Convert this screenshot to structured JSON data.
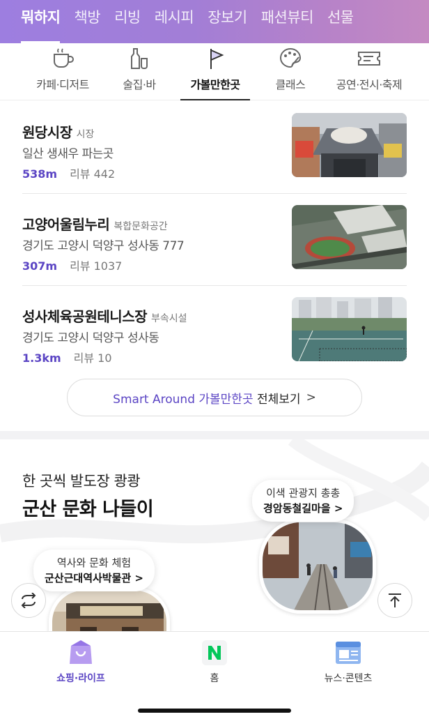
{
  "top_nav": {
    "tabs": [
      "뭐하지",
      "책방",
      "리빙",
      "레시피",
      "장보기",
      "패션뷰티",
      "선물"
    ],
    "active_index": 0
  },
  "categories": {
    "items": [
      {
        "label": "카페·디저트",
        "icon": "coffee-cup-icon"
      },
      {
        "label": "술집·바",
        "icon": "bottles-icon"
      },
      {
        "label": "가볼만한곳",
        "icon": "flag-icon"
      },
      {
        "label": "클래스",
        "icon": "palette-icon"
      },
      {
        "label": "공연·전시·축제",
        "icon": "ticket-icon"
      }
    ],
    "active_index": 2
  },
  "places": [
    {
      "name": "원당시장",
      "kind": "시장",
      "address": "일산 생새우 파는곳",
      "distance": "538m",
      "reviews": "리뷰 442"
    },
    {
      "name": "고양어울림누리",
      "kind": "복합문화공간",
      "address": "경기도 고양시 덕양구 성사동 777",
      "distance": "307m",
      "reviews": "리뷰 1037"
    },
    {
      "name": "성사체육공원테니스장",
      "kind": "부속시설",
      "address": "경기도 고양시 덕양구 성사동",
      "distance": "1.3km",
      "reviews": "리뷰 10"
    }
  ],
  "see_all": {
    "brand": "Smart Around 가볼만한곳",
    "text": "전체보기",
    "arrow": ">"
  },
  "promo": {
    "subtitle": "한 곳씩 발도장 쾅쾅",
    "title": "군산 문화 나들이",
    "spot_right": {
      "line1": "이색 관광지 총총",
      "line2": "경암동철길마을 >"
    },
    "spot_left": {
      "line1": "역사와 문화 체험",
      "line2": "군산근대역사박물관 >"
    }
  },
  "bottom_nav": {
    "items": [
      {
        "label": "쇼핑·라이프",
        "icon": "shopping-bag-icon"
      },
      {
        "label": "홈",
        "icon": "naver-n-icon"
      },
      {
        "label": "뉴스·콘텐츠",
        "icon": "news-icon"
      }
    ],
    "active_index": 0
  },
  "colors": {
    "accent": "#5b45c4",
    "nav_gradient_start": "#9d7ee0",
    "nav_gradient_end": "#c48ac2",
    "naver_green": "#03c75a"
  }
}
